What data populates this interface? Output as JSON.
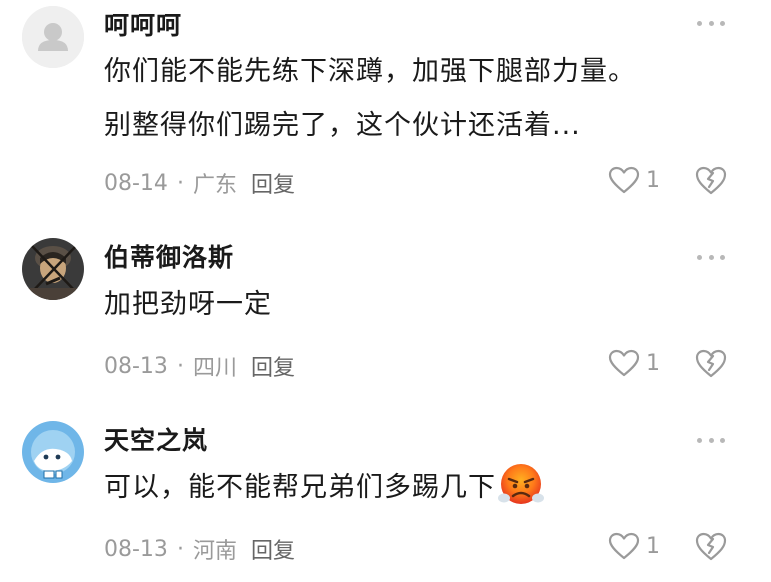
{
  "comments": [
    {
      "username": "呵呵呵",
      "lines": [
        "你们能不能先练下深蹲，加强下腿部力量。",
        "别整得你们踢完了，这个伙计还活着..."
      ],
      "date": "08-14",
      "separator": "·",
      "location": "广东",
      "reply_label": "回复",
      "like_count": "1",
      "avatar_icon": "default-user-avatar"
    },
    {
      "username": "伯蒂御洛斯",
      "lines": [
        "加把劲呀一定"
      ],
      "date": "08-13",
      "separator": "·",
      "location": "四川",
      "reply_label": "回复",
      "like_count": "1",
      "avatar_icon": "sketch-figure-avatar"
    },
    {
      "username": "天空之岚",
      "lines": [
        "可以，能不能帮兄弟们多踢几下"
      ],
      "emoji": "angry-steam-emoji",
      "date": "08-13",
      "separator": "·",
      "location": "河南",
      "reply_label": "回复",
      "like_count": "1",
      "avatar_icon": "blue-cartoon-avatar"
    }
  ],
  "colors": {
    "text": "#1a1a1a",
    "meta": "#9a9a9a",
    "reply": "#666666",
    "icon": "#b8b8b8"
  }
}
